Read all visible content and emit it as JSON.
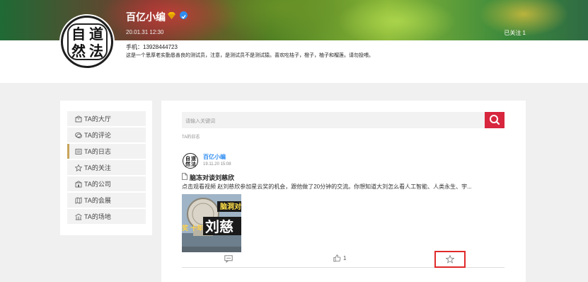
{
  "profile": {
    "username": "百亿小编",
    "avatar_text": [
      "自",
      "道",
      "然",
      "法"
    ],
    "registered": "20.01.31 12:30",
    "follow_count": "已关注 1",
    "phone": "手机：13928444723",
    "bio": "这是一个思厚老实勤恳善良的测试员，注意，是测试员不是测试猿。喜欢吃桔子，橙子，柚子和榴莲。请勿投喂。",
    "badges": [
      "diamond-icon",
      "verified-icon"
    ]
  },
  "sidebar": {
    "items": [
      {
        "label": "TA的大厅",
        "icon": "hall-icon"
      },
      {
        "label": "TA的评论",
        "icon": "comment-icon"
      },
      {
        "label": "TA的日志",
        "icon": "log-icon",
        "active": true
      },
      {
        "label": "TA的关注",
        "icon": "star-icon"
      },
      {
        "label": "TA的公司",
        "icon": "company-icon"
      },
      {
        "label": "TA的会展",
        "icon": "expo-icon"
      },
      {
        "label": "TA的场地",
        "icon": "venue-icon"
      }
    ]
  },
  "search": {
    "placeholder": "请输入关键词",
    "button_icon": "search-icon"
  },
  "crumb": "TA的日志",
  "post": {
    "author": "百亿小编",
    "time": "19.11.20 15:08",
    "title": "脑冻对谈刘慈欣",
    "summary": "点击观看视频 赵刘慈欣参加星云奖的机会，跟他做了20分钟的交流。你想知道大刘怎么看人工智能、人类永生、宇...",
    "thumb_texts": {
      "top": "脑洞对",
      "main": "刘慈",
      "left": "奖 十年"
    },
    "like_count": "1"
  },
  "colors": {
    "accent_red": "#d7263d",
    "link_blue": "#2f8cf0",
    "active_marker": "#c8a45a"
  }
}
